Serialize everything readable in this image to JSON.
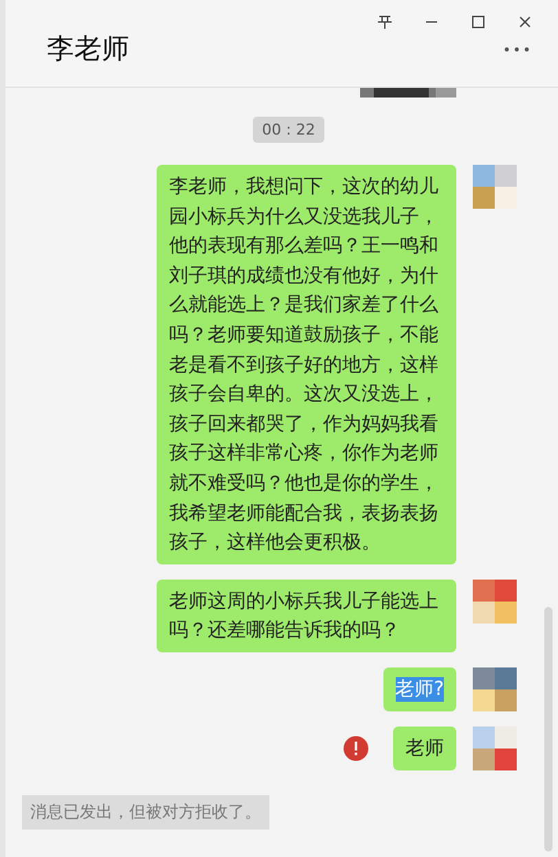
{
  "window": {
    "title": "李老师"
  },
  "chat": {
    "time": "00 : 22",
    "messages": [
      {
        "text": "李老师，我想问下，这次的幼儿园小标兵为什么又没选我儿子，他的表现有那么差吗？王一鸣和刘子琪的成绩也没有他好，为什么就能选上？是我们家差了什么吗？老师要知道鼓励孩子，不能老是看不到孩子好的地方，这样孩子会自卑的。这次又没选上，孩子回来都哭了，作为妈妈我看孩子这样非常心疼，你作为老师就不难受吗？他也是你的学生，我希望老师能配合我，表扬表扬孩子，这样他会更积极。",
        "highlighted": false,
        "failed": false
      },
      {
        "text": "老师这周的小标兵我儿子能选上吗？还差哪能告诉我的吗？",
        "highlighted": false,
        "failed": false
      },
      {
        "text": "老师?",
        "highlighted": true,
        "failed": false
      },
      {
        "text": "老师",
        "highlighted": false,
        "failed": true
      }
    ],
    "system_notice": "消息已发出，但被对方拒收了。"
  }
}
